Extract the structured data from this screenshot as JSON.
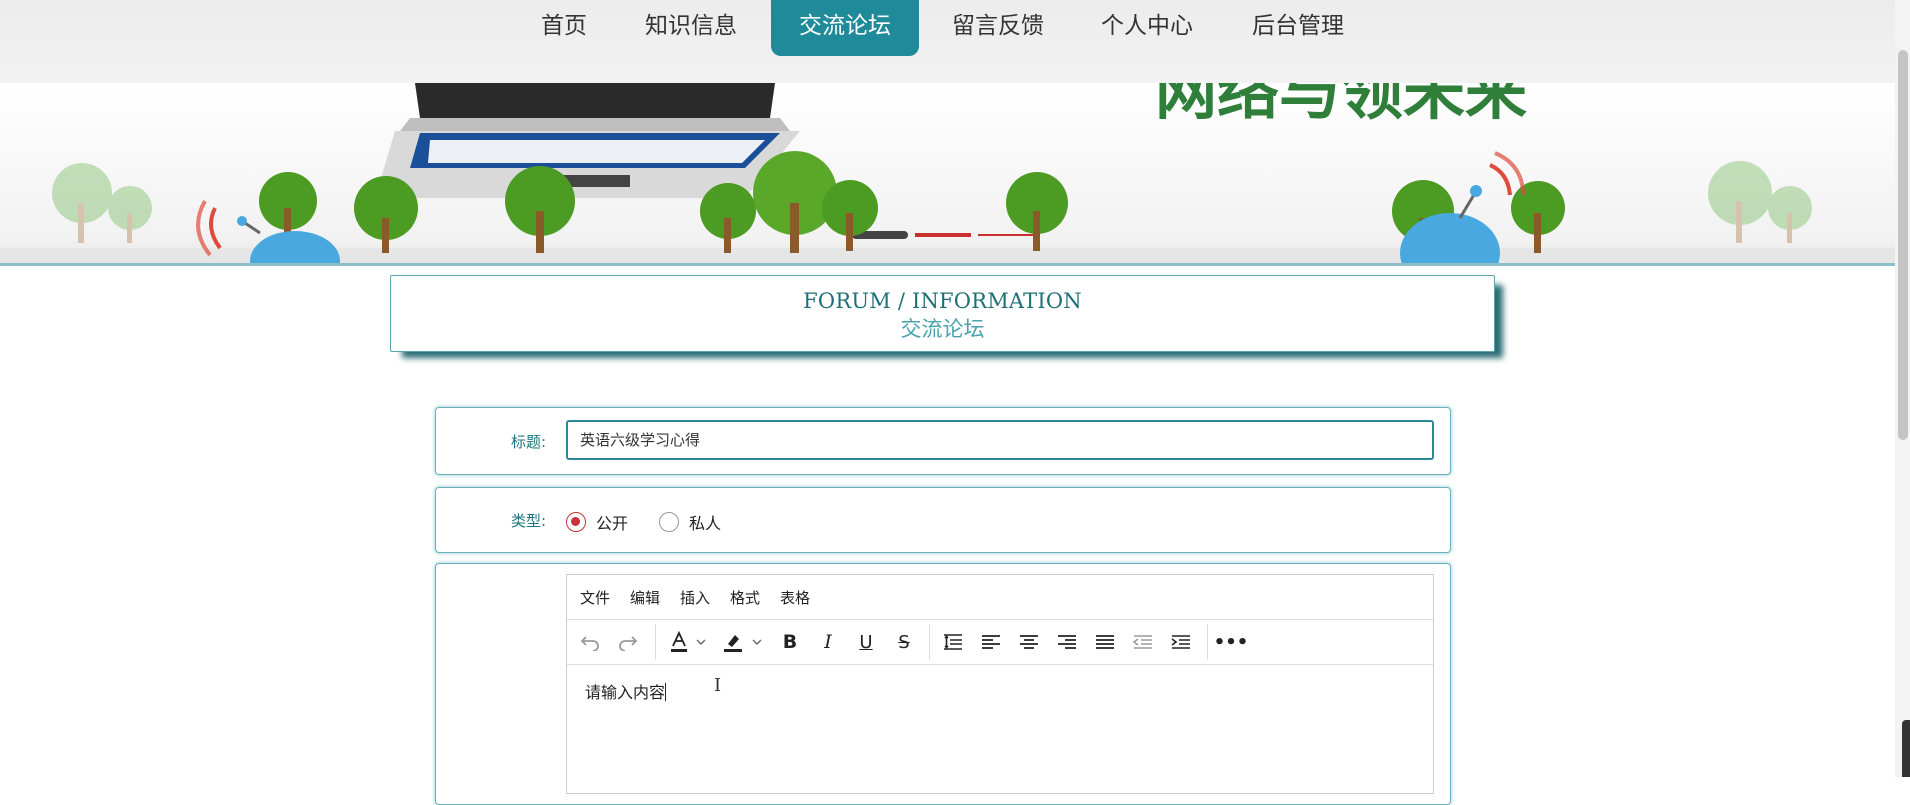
{
  "nav": {
    "items": [
      {
        "label": "首页"
      },
      {
        "label": "知识信息"
      },
      {
        "label": "交流论坛",
        "active": true
      },
      {
        "label": "留言反馈"
      },
      {
        "label": "个人中心"
      },
      {
        "label": "后台管理"
      }
    ]
  },
  "banner": {
    "heading_text": "网络与领未来"
  },
  "section": {
    "title_en": "FORUM / INFORMATION",
    "title_cn": "交流论坛"
  },
  "form": {
    "title_label": "标题:",
    "title_value": "英语六级学习心得",
    "type_label": "类型:",
    "type_options": [
      {
        "label": "公开",
        "checked": true
      },
      {
        "label": "私人",
        "checked": false
      }
    ]
  },
  "editor": {
    "menu": [
      "文件",
      "编辑",
      "插入",
      "格式",
      "表格"
    ],
    "content": "请输入内容"
  },
  "colors": {
    "accent": "#1f8a99",
    "radio_checked": "#c8313a",
    "label": "#1e7580"
  }
}
